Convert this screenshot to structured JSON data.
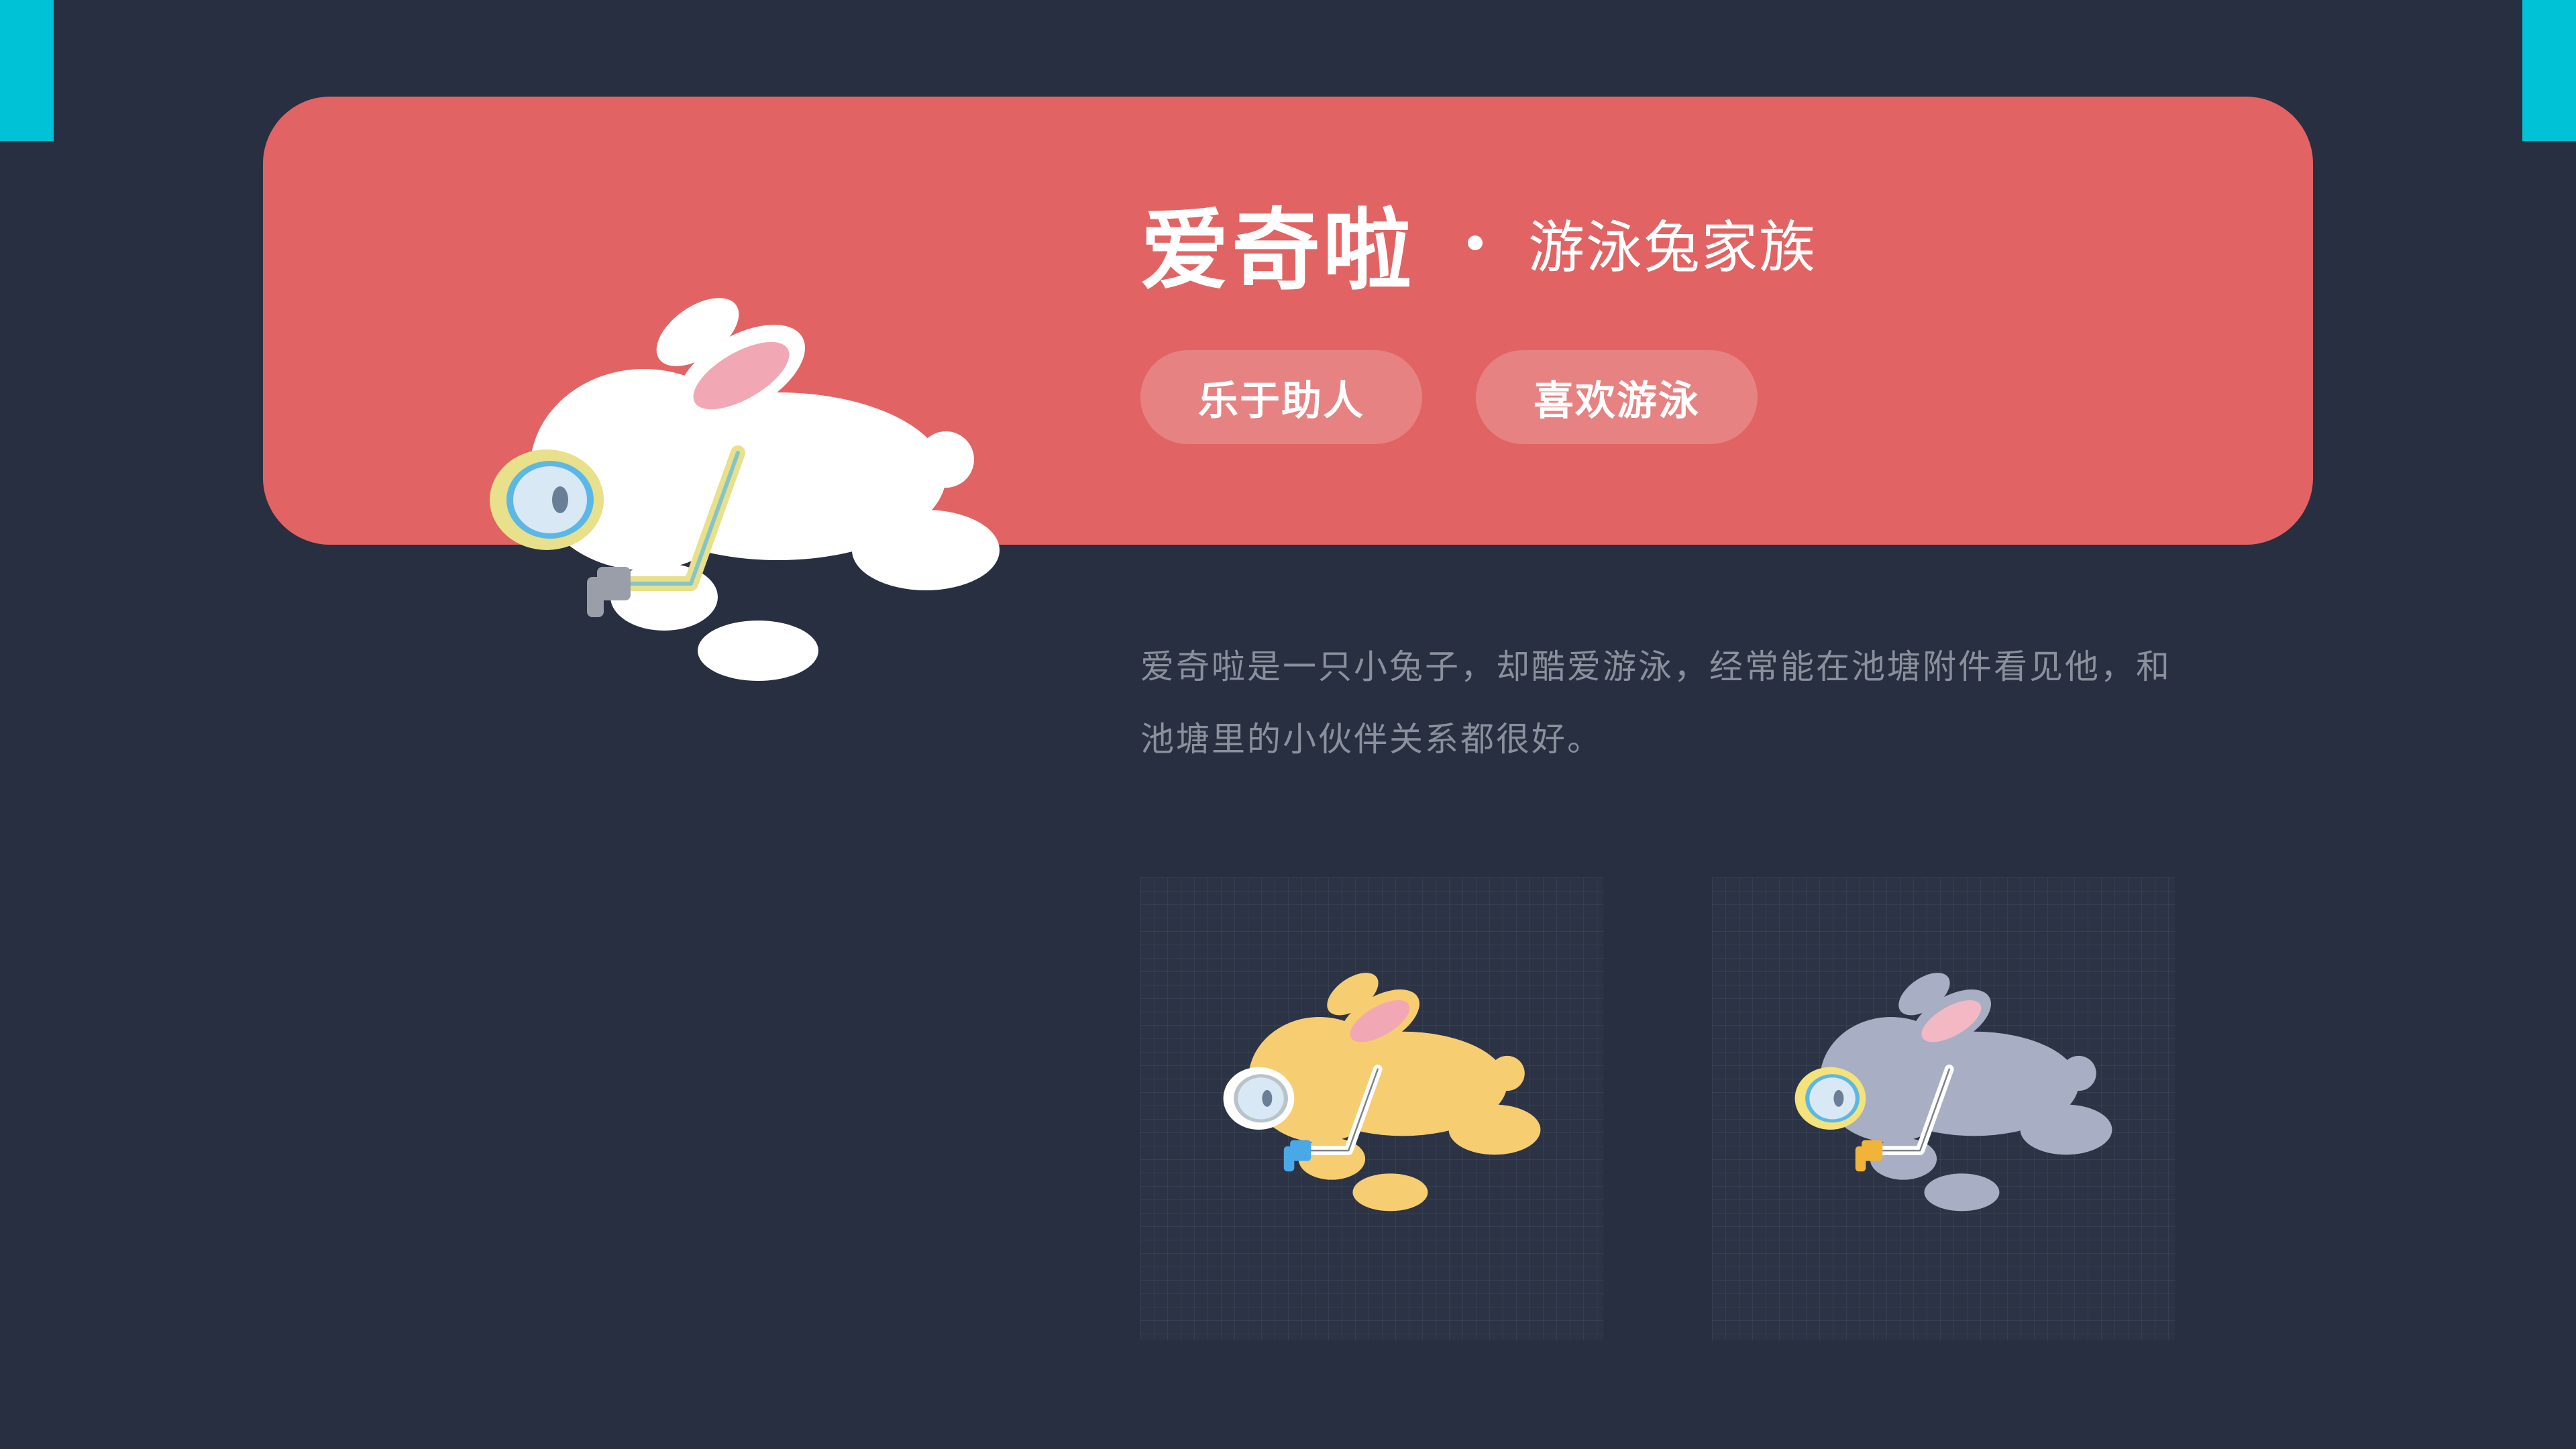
{
  "colors": {
    "background": "#272f40",
    "accent_cyan": "#00c2d6",
    "banner": "#e26363",
    "tag_fill": "rgba(255,255,255,0.2)",
    "text_white": "#ffffff",
    "description_text": "#8a909c",
    "rabbit_white": "#ffffff",
    "rabbit_yellow": "#f7cd72",
    "rabbit_gray": "#a8aec4"
  },
  "header": {
    "name": "爱奇啦",
    "family": "游泳兔家族"
  },
  "tags": [
    "乐于助人",
    "喜欢游泳"
  ],
  "description": {
    "line1": "爱奇啦是一只小兔子，却酷爱游泳，经常能在池塘附件看见他，和",
    "line2": "池塘里的小伙伴关系都很好。"
  },
  "illustrations": {
    "hero": "white-rabbit-snorkel-icon",
    "variant1": "yellow-rabbit-snorkel-icon",
    "variant2": "gray-rabbit-snorkel-icon"
  }
}
